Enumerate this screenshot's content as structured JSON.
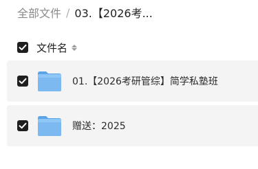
{
  "breadcrumb": {
    "root": "全部文件",
    "separator": "/",
    "current": "03.【2026考..."
  },
  "list_header": {
    "name_label": "文件名",
    "select_all_checked": true
  },
  "files": [
    {
      "name": "01.【2026考研管综】简学私塾班",
      "type": "folder",
      "checked": true
    },
    {
      "name": "赠送：2025",
      "type": "folder",
      "checked": true
    }
  ],
  "colors": {
    "folder": "#7cb9f0",
    "row_background": "#f4f4f5",
    "checkbox": "#1f1f1f"
  },
  "icons": [
    "checkbox-checked-icon",
    "sort-icon",
    "folder-icon"
  ]
}
